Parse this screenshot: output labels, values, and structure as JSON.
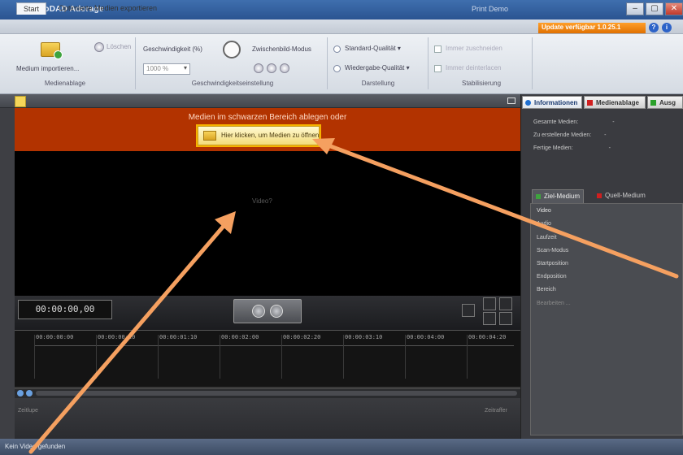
{
  "window": {
    "title": "proDAD Adorage",
    "middle_text": "Print Demo",
    "buttons": [
      "–",
      "▢",
      "✕"
    ]
  },
  "ribbon_tabs": [
    {
      "label": "Start",
      "active": true
    },
    {
      "label": "Optimierte Medien exportieren",
      "active": false
    }
  ],
  "update_banner": "Update verfügbar 1.0.25.1",
  "help_icons": [
    "?",
    "i"
  ],
  "ribbon": {
    "import_label": "Medium importieren...",
    "import_extra": "Löschen",
    "speed_label": "Geschwindigkeit (%)",
    "speed_value": "1000 %",
    "interframe_label": "Zwischenbild-Modus",
    "standard_quality": "Standard-Qualität ▾",
    "playback_quality": "Wiedergabe-Qualität ▾",
    "opt1": "Immer zuschneiden",
    "opt2": "Immer deinterlacen",
    "groups": {
      "media_storage": "Medienablage",
      "speed_settings": "Geschwindigkeitseinstellung",
      "display": "Darstellung",
      "stabilization": "Stabilisierung"
    }
  },
  "workspace": {
    "drop_text": "Medien im schwarzen Bereich ablegen oder",
    "drop_button": "Hier klicken, um Medien zu öffnen...",
    "video_label": "Video?",
    "timecode": "00:00:00,00",
    "timeline_ticks": [
      "00:00:00:00",
      "00:00:00:20",
      "00:00:01:10",
      "00:00:02:00",
      "00:00:02:20",
      "00:00:03:10",
      "00:00:04:00",
      "00:00:04:20"
    ],
    "bottom_left": "Zeitlupe",
    "bottom_right": "Zeitraffer"
  },
  "right_panel": {
    "tabs": [
      {
        "label": "Informationen",
        "color": "#1f6fd0"
      },
      {
        "label": "Medienablage",
        "color": "#d01f1f"
      },
      {
        "label": "Ausg",
        "color": "#2aa02a"
      }
    ],
    "info_rows": [
      {
        "label": "Gesamte Medien:",
        "value": "-"
      },
      {
        "label": "Zu erstellende Medien:",
        "value": "-"
      },
      {
        "label": "Fertige Medien:",
        "value": "-"
      }
    ],
    "subtabs": [
      {
        "label": "Ziel-Medium",
        "color": "#3ea33e",
        "active": true
      },
      {
        "label": "Quell-Medium",
        "color": "#d01f1f",
        "active": false
      }
    ],
    "detail_rows": [
      "Video",
      "Audio",
      "Laufzeit",
      "Scan-Modus",
      "Startposition",
      "Endposition",
      "Bereich",
      "Bearbeiten ..."
    ]
  },
  "status": {
    "text": "Kein Video gefunden"
  },
  "colors": {
    "drop_area": "#b23300",
    "annotation_arrow": "#f5a060"
  }
}
